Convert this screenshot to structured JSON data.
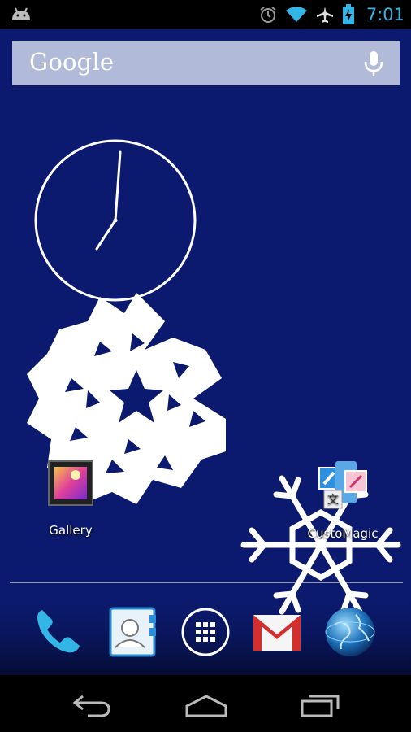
{
  "status_bar": {
    "time": "7:01",
    "time_color": "#33b5e5",
    "icons": [
      "android-notification-icon",
      "alarm-icon",
      "wifi-icon",
      "airplane-mode-icon",
      "battery-charging-icon"
    ]
  },
  "search_bar": {
    "logo_text": "Google",
    "mic_icon": "mic-icon"
  },
  "widgets": {
    "analog_clock": {
      "hours": 7,
      "minutes": 1
    }
  },
  "home_apps": [
    {
      "label": "Gallery",
      "icon": "gallery-icon"
    },
    {
      "label": "CustoMagic",
      "icon": "customagic-icon"
    }
  ],
  "dock": [
    {
      "name": "phone",
      "icon": "phone-icon"
    },
    {
      "name": "people",
      "icon": "contacts-icon"
    },
    {
      "name": "apps",
      "icon": "app-drawer-icon"
    },
    {
      "name": "gmail",
      "icon": "gmail-icon"
    },
    {
      "name": "browser",
      "icon": "globe-icon"
    }
  ],
  "nav_bar": [
    "back-icon",
    "home-icon",
    "recent-apps-icon"
  ],
  "colors": {
    "wallpaper": "#0b1a6e",
    "accent": "#33b5e5"
  }
}
